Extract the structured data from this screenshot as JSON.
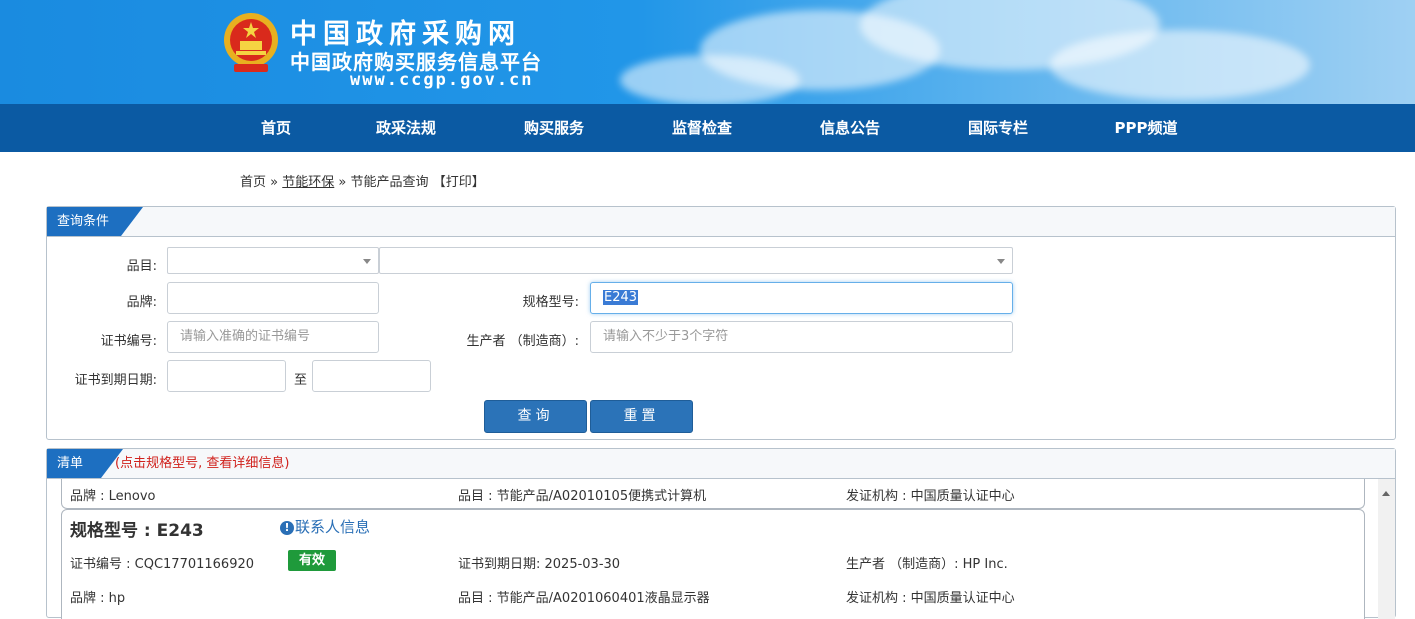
{
  "header": {
    "site_title": "中国政府采购网",
    "site_subtitle": "中国政府购买服务信息平台",
    "site_url": "www.ccgp.gov.cn"
  },
  "nav": [
    {
      "label": "首页"
    },
    {
      "label": "政采法规"
    },
    {
      "label": "购买服务"
    },
    {
      "label": "监督检查"
    },
    {
      "label": "信息公告"
    },
    {
      "label": "国际专栏"
    },
    {
      "label": "PPP频道"
    }
  ],
  "breadcrumb": {
    "home": "首页",
    "sep1": "»",
    "section": "节能环保",
    "sep2": "»",
    "current": "节能产品查询",
    "print": "【打印】"
  },
  "query": {
    "tab_label": "查询条件",
    "category_label": "品目:",
    "brand_label": "品牌:",
    "brand_value": "",
    "model_label": "规格型号:",
    "model_value": "E243",
    "cert_no_label": "证书编号:",
    "cert_no_placeholder": "请输入准确的证书编号",
    "manufacturer_label": "生产者 （制造商）:",
    "manufacturer_placeholder": "请输入不少于3个字符",
    "expiry_label": "证书到期日期:",
    "to_label": "至",
    "search_button": "查询",
    "reset_button": "重置"
  },
  "results": {
    "tab_label": "清单",
    "hint": "(点击规格型号, 查看详细信息)",
    "partial_row": {
      "brand": "品牌 : Lenovo",
      "category": "品目 : 节能产品/A02010105便携式计算机",
      "issuer": "发证机构 : 中国质量认证中心"
    },
    "card": {
      "model": "规格型号 : E243",
      "contact": "联系人信息",
      "cert_no": "证书编号 : CQC17701166920",
      "status": "有效",
      "expiry": "证书到期日期: 2025-03-30",
      "manufacturer": "生产者 （制造商）: HP Inc.",
      "brand": "品牌 : hp",
      "category": "品目 : 节能产品/A0201060401液晶显示器",
      "issuer": "发证机构 : 中国质量认证中心"
    }
  },
  "colors": {
    "nav_bg": "#0b5aa3",
    "tab_bg": "#1d6fc1",
    "valid_badge": "#1f9a3b",
    "hint_red": "#d0211c"
  }
}
